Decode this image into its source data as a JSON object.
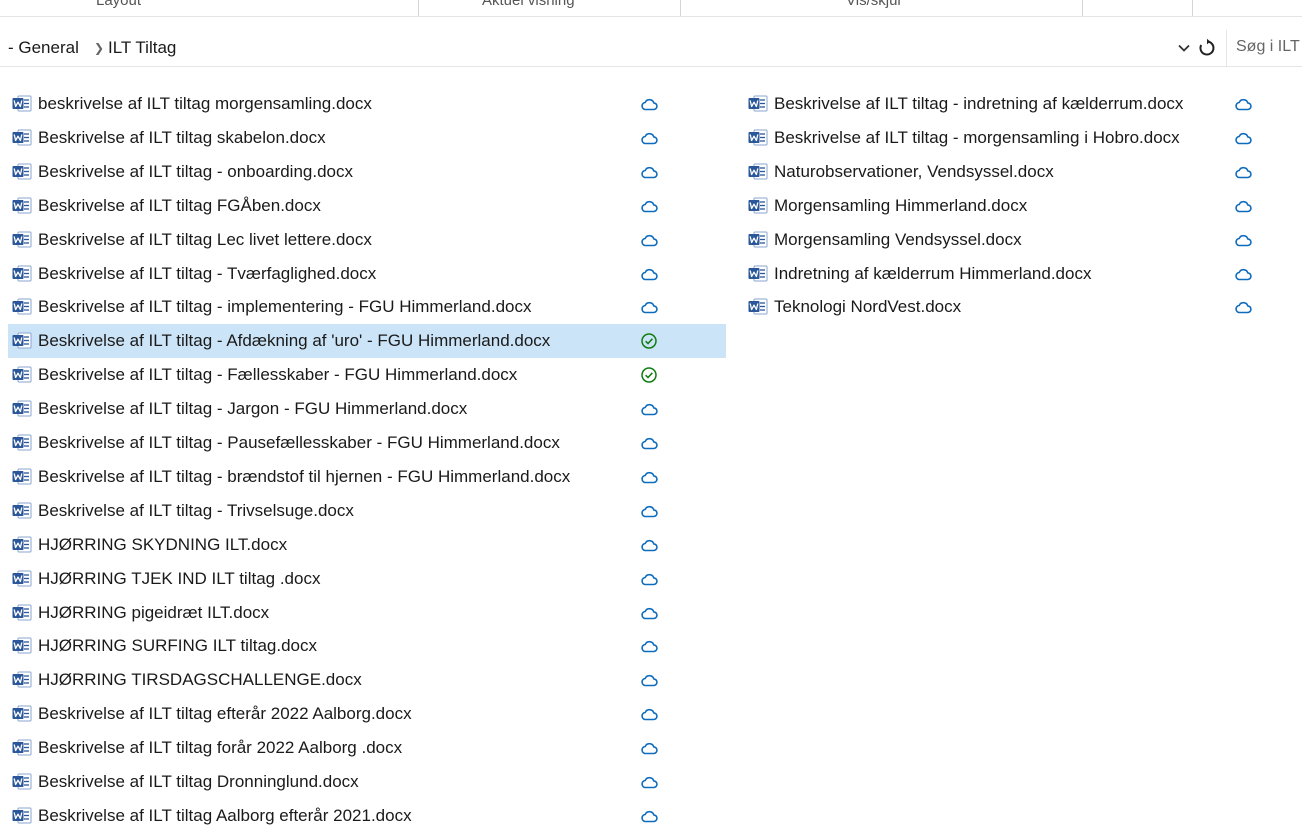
{
  "ribbon": {
    "groups": [
      "Layout",
      "Aktuel visning",
      "Vis/skjul"
    ]
  },
  "address": {
    "crumbs": [
      "- General",
      "ILT Tiltag"
    ],
    "search_placeholder": "Søg i ILT"
  },
  "files": {
    "column1": [
      {
        "name": "beskrivelse af ILT tiltag morgensamling.docx",
        "status": "cloud"
      },
      {
        "name": "Beskrivelse af ILT tiltag skabelon.docx",
        "status": "cloud"
      },
      {
        "name": "Beskrivelse af ILT tiltag - onboarding.docx",
        "status": "cloud"
      },
      {
        "name": "Beskrivelse af ILT tiltag FGÅben.docx",
        "status": "cloud"
      },
      {
        "name": "Beskrivelse af ILT tiltag Lec livet lettere.docx",
        "status": "cloud"
      },
      {
        "name": "Beskrivelse af ILT tiltag - Tværfaglighed.docx",
        "status": "cloud"
      },
      {
        "name": "Beskrivelse af ILT tiltag - implementering - FGU Himmerland.docx",
        "status": "cloud"
      },
      {
        "name": "Beskrivelse af ILT tiltag - Afdækning af 'uro' - FGU Himmerland.docx",
        "status": "synced",
        "selected": true
      },
      {
        "name": "Beskrivelse af ILT tiltag - Fællesskaber - FGU Himmerland.docx",
        "status": "synced"
      },
      {
        "name": "Beskrivelse af ILT tiltag - Jargon - FGU Himmerland.docx",
        "status": "cloud"
      },
      {
        "name": "Beskrivelse af ILT tiltag - Pausefællesskaber - FGU Himmerland.docx",
        "status": "cloud"
      },
      {
        "name": "Beskrivelse af ILT tiltag - brændstof til hjernen - FGU Himmerland.docx",
        "status": "cloud"
      },
      {
        "name": "Beskrivelse af ILT tiltag - Trivselsuge.docx",
        "status": "cloud"
      },
      {
        "name": "HJØRRING SKYDNING ILT.docx",
        "status": "cloud"
      },
      {
        "name": "HJØRRING TJEK IND ILT tiltag .docx",
        "status": "cloud"
      },
      {
        "name": "HJØRRING pigeidræt ILT.docx",
        "status": "cloud"
      },
      {
        "name": "HJØRRING SURFING ILT tiltag.docx",
        "status": "cloud"
      },
      {
        "name": "HJØRRING TIRSDAGSCHALLENGE.docx",
        "status": "cloud"
      },
      {
        "name": "Beskrivelse af ILT tiltag efterår 2022 Aalborg.docx",
        "status": "cloud"
      },
      {
        "name": "Beskrivelse af ILT tiltag forår 2022 Aalborg .docx",
        "status": "cloud"
      },
      {
        "name": "Beskrivelse af ILT tiltag Dronninglund.docx",
        "status": "cloud"
      },
      {
        "name": "Beskrivelse af ILT tiltag Aalborg efterår 2021.docx",
        "status": "cloud"
      }
    ],
    "column2": [
      {
        "name": "Beskrivelse af ILT tiltag - indretning af kælderrum.docx",
        "status": "cloud"
      },
      {
        "name": "Beskrivelse af ILT tiltag - morgensamling i Hobro.docx",
        "status": "cloud"
      },
      {
        "name": "Naturobservationer, Vendsyssel.docx",
        "status": "cloud"
      },
      {
        "name": "Morgensamling Himmerland.docx",
        "status": "cloud"
      },
      {
        "name": "Morgensamling Vendsyssel.docx",
        "status": "cloud"
      },
      {
        "name": "Indretning af kælderrum Himmerland.docx",
        "status": "cloud"
      },
      {
        "name": "Teknologi NordVest.docx",
        "status": "cloud"
      }
    ]
  },
  "colors": {
    "selection": "#cce4f7",
    "cloud_icon": "#0f6cbd",
    "synced_icon": "#107c10",
    "word_blue": "#2b579a"
  }
}
